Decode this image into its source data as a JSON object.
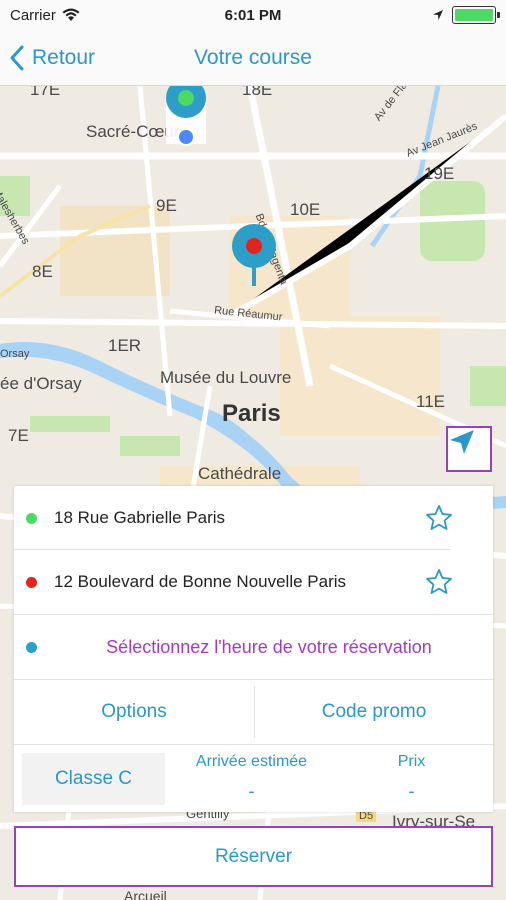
{
  "status_bar": {
    "carrier": "Carrier",
    "time": "6:01 PM"
  },
  "nav": {
    "back_label": "Retour",
    "title": "Votre course"
  },
  "map": {
    "labels": {
      "arr17": "17E",
      "arr18": "18E",
      "sacre_coeur": "Sacré-Cœur",
      "arr9": "9E",
      "arr10": "10E",
      "arr19": "19E",
      "arr8": "8E",
      "arr1": "1ER",
      "orsay": "ée d'Orsay",
      "louvre": "Musée du Louvre",
      "paris": "Paris",
      "arr11": "11E",
      "arr7": "7E",
      "cathedrale": "Cathédrale",
      "rue_reaumur": "Rue Réaumur",
      "bd_magenta": "Bd de Magenta",
      "av_jean_jaures": "Av Jean Jaurès",
      "av_flandre": "Av de Flandre",
      "malesherbes": "Malesherbes",
      "orsay_small": "Orsay",
      "gentilly": "Gentilly",
      "ivry": "Ivry-sur-Se",
      "arcueil": "Arcueil",
      "d5": "D5"
    },
    "colors": {
      "pickup": "#4cd964",
      "dropoff": "#e0261c",
      "pin": "#2d9ec8",
      "water": "#a9d3f5",
      "park": "#c8e6b0",
      "road": "#ffffff",
      "major_road": "#f7e3a8"
    }
  },
  "panel": {
    "pickup_address": "18 Rue Gabrielle Paris",
    "dropoff_address": "12 Boulevard de Bonne Nouvelle Paris",
    "time_prompt": "Sélectionnez l'heure de votre réservation",
    "options_label": "Options",
    "promo_label": "Code promo",
    "class_label": "Classe C",
    "eta_label": "Arrivée estimée",
    "eta_value": "-",
    "price_label": "Prix",
    "price_value": "-"
  },
  "reserve_label": "Réserver",
  "icons": {
    "back": "chevron-left-icon",
    "star": "star-outline-icon",
    "locate": "navigation-arrow-icon",
    "wifi": "wifi-icon",
    "location": "location-arrow-icon",
    "battery": "battery-icon"
  }
}
